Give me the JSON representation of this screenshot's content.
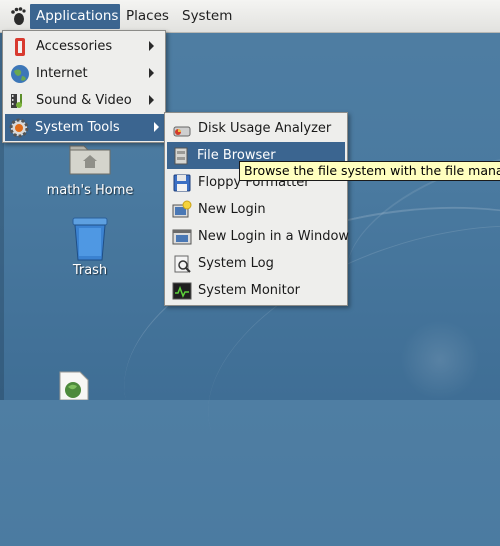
{
  "panel": {
    "menus": [
      "Applications",
      "Places",
      "System"
    ],
    "logo_icon": "gnome-foot-icon"
  },
  "applications_menu": {
    "items": [
      {
        "label": "Accessories",
        "icon": "accessories-icon",
        "has_submenu": true
      },
      {
        "label": "Internet",
        "icon": "internet-globe-icon",
        "has_submenu": true
      },
      {
        "label": "Sound & Video",
        "icon": "sound-video-icon",
        "has_submenu": true
      },
      {
        "label": "System Tools",
        "icon": "system-tools-gear-icon",
        "has_submenu": true,
        "selected": true
      }
    ]
  },
  "system_tools_menu": {
    "items": [
      {
        "label": "Disk Usage Analyzer",
        "icon": "disk-usage-icon"
      },
      {
        "label": "File Browser",
        "icon": "file-cabinet-icon",
        "selected": true
      },
      {
        "label": "Floppy Formatter",
        "icon": "floppy-icon"
      },
      {
        "label": "New Login",
        "icon": "new-login-icon"
      },
      {
        "label": "New Login in a Window",
        "icon": "new-login-window-icon"
      },
      {
        "label": "System Log",
        "icon": "system-log-icon"
      },
      {
        "label": "System Monitor",
        "icon": "system-monitor-icon"
      }
    ]
  },
  "tooltip": {
    "text": "Browse the file system with the file manager"
  },
  "desktop": {
    "icons": [
      {
        "label": "math's Home",
        "icon": "home-folder-icon"
      },
      {
        "label": "Trash",
        "icon": "trash-icon"
      },
      {
        "label": "",
        "icon": "web-document-icon"
      }
    ]
  },
  "colors": {
    "highlight": "#3b6590",
    "menu_bg": "#eeeeec",
    "tooltip_bg": "#ffffbf",
    "desktop_bg": "#4a7aa0"
  }
}
